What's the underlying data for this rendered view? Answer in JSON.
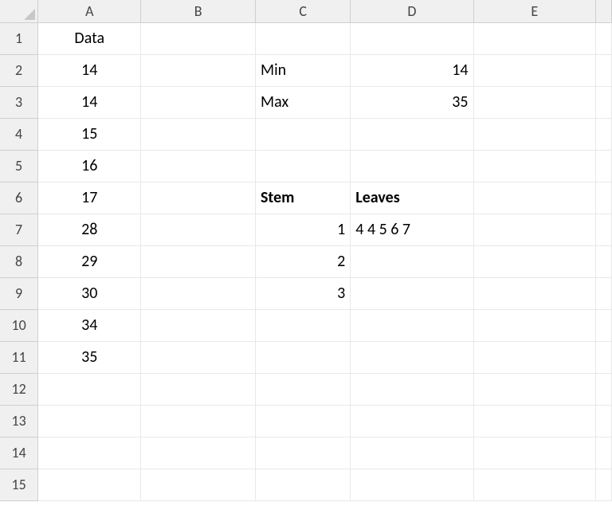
{
  "columns": [
    "A",
    "B",
    "C",
    "D",
    "E"
  ],
  "rowCount": 15,
  "cells": {
    "A1": {
      "v": "Data",
      "cls": "ac"
    },
    "A2": {
      "v": "14",
      "cls": "ac"
    },
    "A3": {
      "v": "14",
      "cls": "ac"
    },
    "A4": {
      "v": "15",
      "cls": "ac"
    },
    "A5": {
      "v": "16",
      "cls": "ac"
    },
    "A6": {
      "v": "17",
      "cls": "ac"
    },
    "A7": {
      "v": "28",
      "cls": "ac"
    },
    "A8": {
      "v": "29",
      "cls": "ac"
    },
    "A9": {
      "v": "30",
      "cls": "ac"
    },
    "A10": {
      "v": "34",
      "cls": "ac"
    },
    "A11": {
      "v": "35",
      "cls": "ac"
    },
    "C2": {
      "v": "Min",
      "cls": "al"
    },
    "C3": {
      "v": "Max",
      "cls": "al"
    },
    "D2": {
      "v": "14",
      "cls": "ar"
    },
    "D3": {
      "v": "35",
      "cls": "ar"
    },
    "C6": {
      "v": "Stem",
      "cls": "al bold"
    },
    "D6": {
      "v": "Leaves",
      "cls": "al bold"
    },
    "C7": {
      "v": "1",
      "cls": "ar"
    },
    "C8": {
      "v": "2",
      "cls": "ar"
    },
    "C9": {
      "v": "3",
      "cls": "ar"
    },
    "D7": {
      "v": "4 4 5 6 7",
      "cls": "al"
    }
  }
}
